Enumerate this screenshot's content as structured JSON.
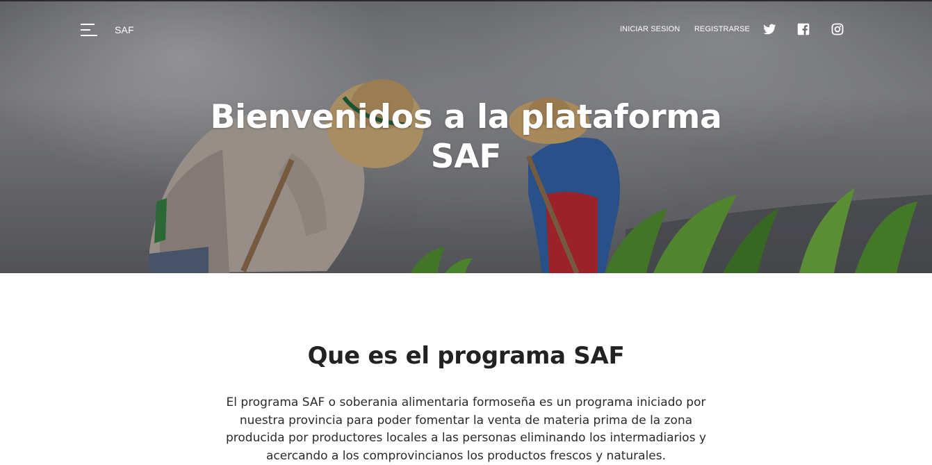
{
  "nav": {
    "brand": "SAF",
    "login_label": "INICIAR SESION",
    "register_label": "REGISTRARSE",
    "social_icons": [
      "twitter-icon",
      "facebook-icon",
      "instagram-icon"
    ]
  },
  "hero": {
    "title": "Bienvenidos a la plataforma SAF"
  },
  "about": {
    "title": "Que es el programa SAF",
    "text": "El programa SAF o soberania alimentaria formoseña es un programa iniciado por nuestra provincia para poder fomentar la venta de materia prima de la zona producida por productores locales a las personas eliminando los intermadiarios y acercando a los comprovincianos los productos frescos y naturales."
  },
  "colors": {
    "text_dark": "#222222",
    "nav_text": "#ffffff",
    "background": "#ffffff"
  }
}
